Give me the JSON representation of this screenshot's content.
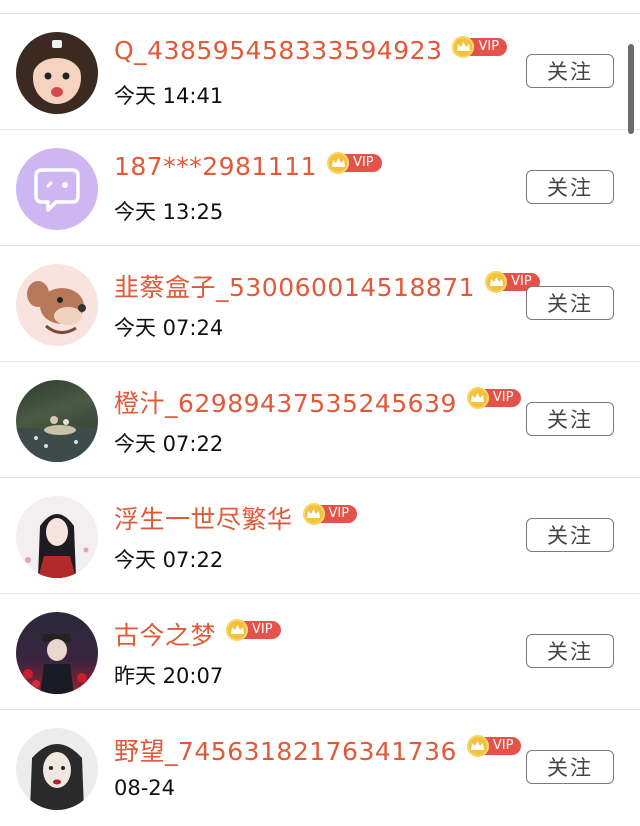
{
  "colors": {
    "name": "#e05a3a",
    "vip_badge": "#e5524a",
    "crown": "#f2c23b",
    "button_border": "#7a7a7a"
  },
  "users": [
    {
      "name": "Q_438595458333594923",
      "time": "今天 14:41",
      "vip": "VIP",
      "button": "关注",
      "avatar_icon": "baby-face-avatar"
    },
    {
      "name": "187***2981111",
      "time": "今天 13:25",
      "vip": "VIP",
      "button": "关注",
      "avatar_icon": "chat-bubble-avatar"
    },
    {
      "name": "韭蔡盒子_530060014518871",
      "time": "今天 07:24",
      "vip": "VIP",
      "button": "关注",
      "avatar_icon": "cartoon-mouse-avatar"
    },
    {
      "name": "橙汁_62989437535245639",
      "time": "今天 07:22",
      "vip": "VIP",
      "button": "关注",
      "avatar_icon": "painting-avatar"
    },
    {
      "name": "浮生一世尽繁华",
      "time": "今天 07:22",
      "vip": "VIP",
      "button": "关注",
      "avatar_icon": "anime-girl-avatar"
    },
    {
      "name": "古今之梦",
      "time": "昨天 20:07",
      "vip": "VIP",
      "button": "关注",
      "avatar_icon": "anime-boy-avatar"
    },
    {
      "name": "野望_74563182176341736",
      "time": "08-24",
      "vip": "VIP",
      "button": "关注",
      "avatar_icon": "portrait-girl-avatar"
    }
  ]
}
